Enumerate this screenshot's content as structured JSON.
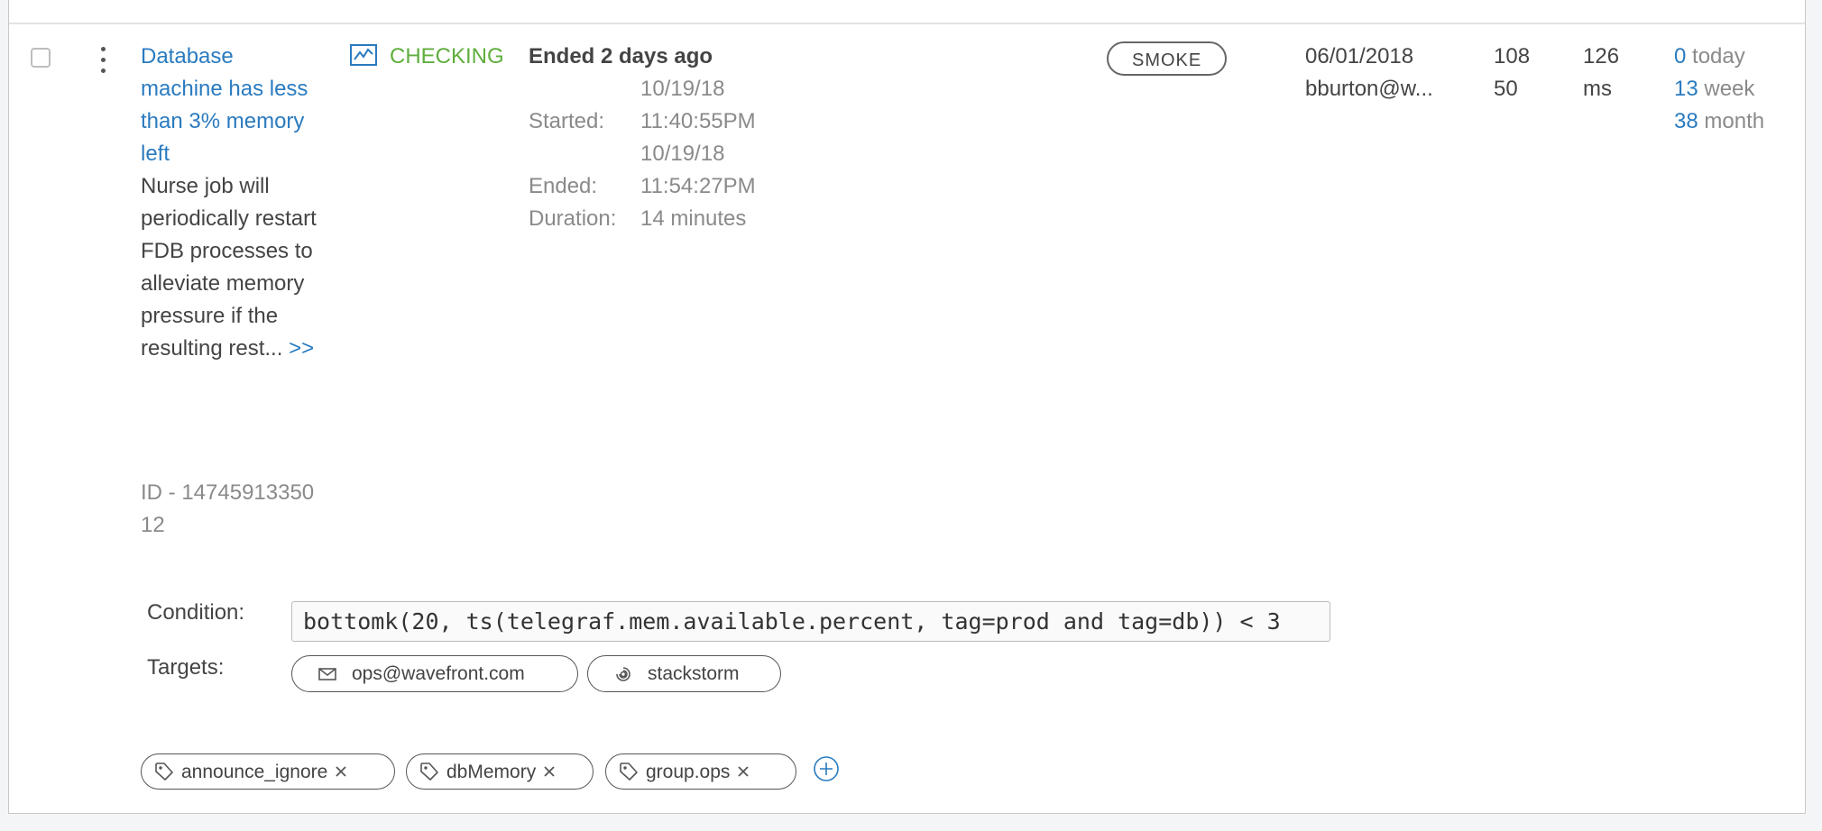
{
  "alert": {
    "name": "Database machine has less than 3% memory left",
    "description": "Nurse job will periodically restart FDB processes to alleviate memory pressure if the resulting rest...",
    "more_link": ">>",
    "id_text": "ID - 1474591335012",
    "status": "CHECKING",
    "ended_summary": "Ended 2 days ago",
    "started_label": "Started:",
    "started_date": "10/19/18",
    "started_time": "11:40:55PM",
    "ended_label": "Ended:",
    "ended_date": "10/19/18",
    "ended_time": "11:54:27PM",
    "duration_label": "Duration:",
    "duration_value": "14 minutes",
    "severity": "SMOKE",
    "updated_date": "06/01/2018",
    "updated_by": "bburton@w...",
    "metric_a": "108",
    "metric_b": "50",
    "latency_value": "126",
    "latency_unit": "ms",
    "fired_today_count": "0",
    "fired_today_label": "today",
    "fired_week_count": "13",
    "fired_week_label": "week",
    "fired_month_count": "38",
    "fired_month_label": "month"
  },
  "condition": {
    "label": "Condition:",
    "query": "bottomk(20, ts(telegraf.mem.available.percent, tag=prod and tag=db)) < 3"
  },
  "targets": {
    "label": "Targets:",
    "items": [
      {
        "label": "ops@wavefront.com",
        "icon": "mail-icon"
      },
      {
        "label": "stackstorm",
        "icon": "stackstorm-icon"
      }
    ]
  },
  "tags": [
    {
      "label": "announce_ignore"
    },
    {
      "label": "dbMemory"
    },
    {
      "label": "group.ops"
    }
  ],
  "colors": {
    "link": "#2a7bbf",
    "status_checking": "#5fae3e",
    "muted": "#8a8a8a"
  }
}
